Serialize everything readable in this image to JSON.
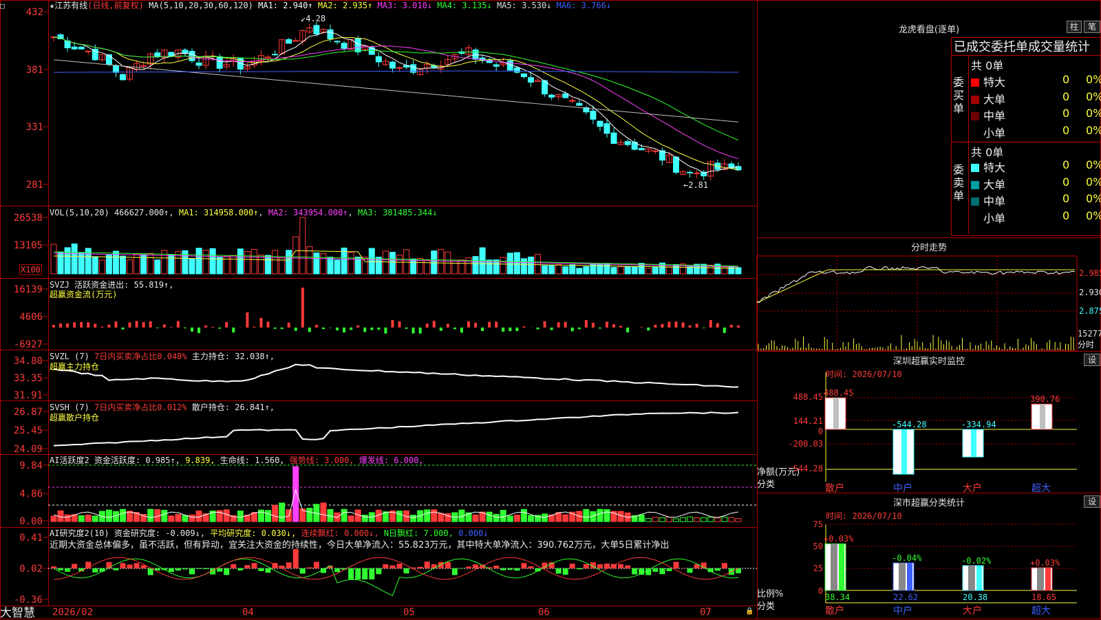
{
  "app": {
    "brand": "大智慧",
    "stock_name": "江苏有线",
    "mode": "(日线,前复权)",
    "ma_label": "MA(5,10,20,30,60,120)",
    "ma_values": [
      {
        "k": "MA1:",
        "v": "2.940↑",
        "c": "#ffffff"
      },
      {
        "k": "MA2:",
        "v": "2.935↑",
        "c": "#ffff40"
      },
      {
        "k": "MA3:",
        "v": "3.010↓",
        "c": "#ff40ff"
      },
      {
        "k": "MA4:",
        "v": "3.135↓",
        "c": "#30ff30"
      },
      {
        "k": "MA5:",
        "v": "3.530↓",
        "c": "#dddddd"
      },
      {
        "k": "MA6:",
        "v": "3.766↓",
        "c": "#4060ff"
      }
    ],
    "high_marker": "4.28",
    "low_marker": "2.81"
  },
  "price_axis": [
    "432",
    "381",
    "331",
    "281"
  ],
  "vol": {
    "label": "VOL(5,10,20)",
    "val": "466627.000↑",
    "ma1": "MA1: 314958.000↑",
    "ma2": "MA2: 343954.000↑",
    "ma3": "MA3: 381485.344↓",
    "axis": [
      "26538",
      "13105"
    ],
    "unit": "X100"
  },
  "svzj": {
    "label": "SVZJ",
    "text": "活跃资金进出: 55.819↑,",
    "sub": "超赢资金流(万元)",
    "axis": [
      "16139",
      "4606",
      "-6927"
    ]
  },
  "svzl": {
    "label": "SVZL (7)",
    "text1": "7日内买卖净占比0.048%",
    "text2": "主力持仓: 32.038↑,",
    "sub": "超赢主力持仓",
    "axis": [
      "34.80",
      "33.35",
      "31.91"
    ]
  },
  "svsh": {
    "label": "SVSH (7)",
    "text1": "7日内买卖净占比0.012%",
    "text2": "散户持仓: 26.841↑,",
    "sub": "超赢散户持仓",
    "axis": [
      "26.87",
      "25.45",
      "24.09"
    ]
  },
  "ai1": {
    "label": "AI活跃度2",
    "t1": "资金活跃度: 0.985↑,",
    "t2": "9.839,",
    "t3": "生命线: 1.560,",
    "t4": "强势线: 3.000,",
    "t5": "爆发线: 6.000,",
    "axis": [
      "9.84",
      "4.86",
      "0.00"
    ]
  },
  "ai2": {
    "label": "AI研究度2(10)",
    "t1": "资金研究度: -0.009↓,",
    "t2": "平均研究度: 0.030↓,",
    "t3": "连续飘红: 0.000↓,",
    "t4": "N日飘红: 7.000,",
    "t5": "0.000↓",
    "comment": "近期大资金总体偏多，虽不活跃，但有异动，宜关注大资金的持续性，今日大单净流入：55.823万元，其中特大单净流入：390.762万元，大单5日累计净出",
    "axis": [
      "0.41",
      "0.02",
      "-0.36"
    ]
  },
  "date_axis": [
    "2026/02",
    "04",
    "05",
    "06",
    "07"
  ],
  "dragon": {
    "title": "龙虎看盘(逐单)",
    "btn1": "柱",
    "btn2": "笔",
    "header": "已成交委托单成交量统计",
    "buy_label": "委买单",
    "sell_label": "委卖单",
    "buy_total": "共 0单",
    "sell_total": "共 0单",
    "buy_rows": [
      {
        "n": "特大",
        "v": "0",
        "p": "0%",
        "c": "#ff0000"
      },
      {
        "n": "大单",
        "v": "0",
        "p": "0%",
        "c": "#a00000"
      },
      {
        "n": "中单",
        "v": "0",
        "p": "0%",
        "c": "#700000"
      },
      {
        "n": "小单",
        "v": "0",
        "p": "0%",
        "c": ""
      }
    ],
    "sell_rows": [
      {
        "n": "特大",
        "v": "0",
        "p": "0%",
        "c": "#40ffff"
      },
      {
        "n": "大单",
        "v": "0",
        "p": "0%",
        "c": "#00a0a0"
      },
      {
        "n": "中单",
        "v": "0",
        "p": "0%",
        "c": "#007070"
      },
      {
        "n": "小单",
        "v": "0",
        "p": "0%",
        "c": ""
      }
    ]
  },
  "intraday": {
    "title": "分时走势",
    "axis": [
      "2.985",
      "2.930",
      "2.875"
    ],
    "vol_label": "15277",
    "unit": "分时"
  },
  "monitor": {
    "title": "深圳超赢实时监控",
    "btn": "设",
    "time": "时间: 2026/07/10",
    "axis": [
      "488.45",
      "144.21",
      "0",
      "-200.03",
      "-544.28"
    ],
    "unit": "净额(万元)",
    "cat_label": "分类",
    "categories": [
      "散户",
      "中户",
      "大户",
      "超大"
    ],
    "values": [
      488.45,
      -544.28,
      -334.94,
      390.76
    ],
    "value_labels": [
      "488.45",
      "-544.28",
      "-334.94",
      "390.76"
    ]
  },
  "classify": {
    "title": "深市超赢分类统计",
    "btn": "设",
    "time": "时间: 2026/07/10",
    "axis": [
      "75",
      "50",
      "25",
      "0"
    ],
    "unit": "比例%",
    "cat_label": "分类",
    "categories": [
      "散户",
      "中户",
      "大户",
      "超大"
    ],
    "values": [
      38.34,
      22.62,
      20.38,
      18.65
    ],
    "changes": [
      "+0.03%",
      "-0.04%",
      "-0.02%",
      "+0.03%"
    ],
    "colors": [
      "#30ff30",
      "#4060ff",
      "#40ffff",
      "#ff3a3a"
    ]
  }
}
